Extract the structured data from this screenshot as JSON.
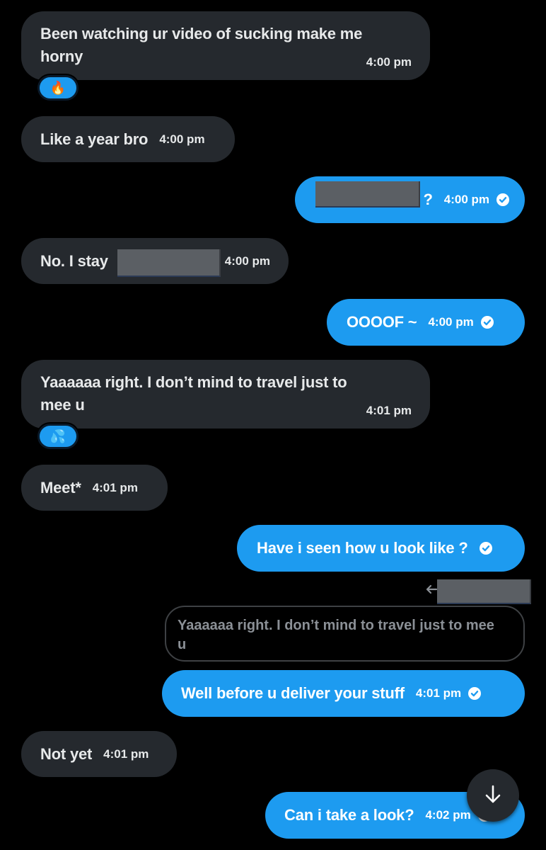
{
  "colors": {
    "background": "#000000",
    "received_bubble": "#25292e",
    "sent_bubble": "#1d9bf0",
    "text": "#e7e9ea",
    "quote_border": "#3e4144"
  },
  "messages": [
    {
      "direction": "received",
      "text_line1": "Been watching ur video of sucking make me",
      "text_line2": "horny",
      "time": "4:00 pm",
      "reaction": "🔥"
    },
    {
      "direction": "received",
      "text": "Like a year bro",
      "time": "4:00 pm"
    },
    {
      "direction": "sent",
      "text_visible": "?",
      "text_redacted": true,
      "time": "4:00 pm",
      "status_icon": "check-circle-icon"
    },
    {
      "direction": "received",
      "text": "No. I stay",
      "text_redacted": true,
      "time": "4:00 pm"
    },
    {
      "direction": "sent",
      "text": "OOOOF ~",
      "time": "4:00 pm",
      "status_icon": "check-circle-icon"
    },
    {
      "direction": "received",
      "text_line1": "Yaaaaaa right. I don’t mind to travel just to",
      "text_line2": "mee u",
      "time": "4:01 pm",
      "reaction": "💦"
    },
    {
      "direction": "received",
      "text": "Meet*",
      "time": "4:01 pm"
    },
    {
      "direction": "sent",
      "text": "Have i seen how u look like ?",
      "status_icon": "check-circle-icon"
    },
    {
      "direction": "sent",
      "reply_icon": "reply-arrow-icon",
      "reply_to_name_redacted": true,
      "quote_line1": "Yaaaaaa right. I don’t mind to travel just to mee",
      "quote_line2": "u",
      "text": "Well before u deliver your stuff",
      "time": "4:01 pm",
      "status_icon": "check-circle-icon"
    },
    {
      "direction": "received",
      "text": "Not yet",
      "time": "4:01 pm"
    },
    {
      "direction": "sent",
      "text": "Can i take a look?",
      "time": "4:02 pm",
      "status_icon": "check-circle-icon"
    }
  ],
  "scroll_button": {
    "icon": "arrow-down-icon"
  }
}
